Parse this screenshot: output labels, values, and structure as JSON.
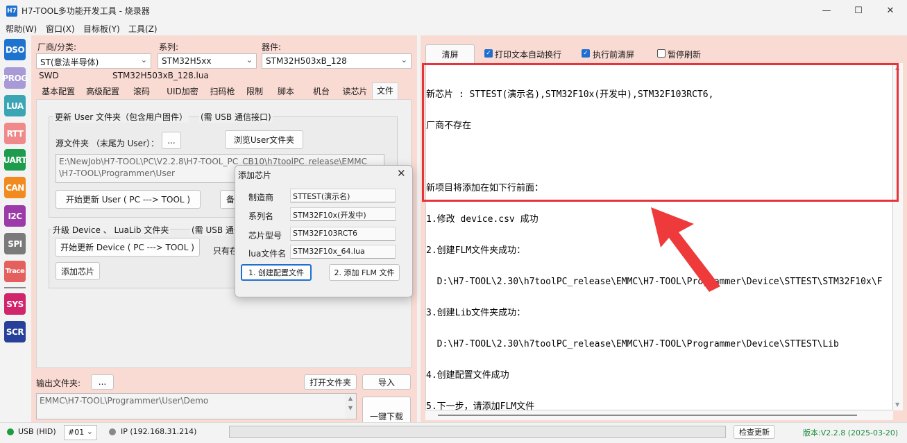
{
  "window": {
    "app_icon_label": "H7",
    "title": "H7-TOOL多功能开发工具 - 烧录器",
    "controls": {
      "minimize": "—",
      "maximize": "☐",
      "close": "✕"
    }
  },
  "menu": [
    {
      "label": "帮助(W)"
    },
    {
      "label": "窗口(X)"
    },
    {
      "label": "目标板(Y)"
    },
    {
      "label": "工具(Z)"
    }
  ],
  "toolbar": [
    {
      "label": "DSO",
      "color": "#1e73cf"
    },
    {
      "label": "PROG",
      "color": "#a89ad6"
    },
    {
      "label": "LUA",
      "color": "#3aa6b4"
    },
    {
      "label": "RTT",
      "color": "#f08a8a"
    },
    {
      "label": "UART",
      "color": "#1c9c4c"
    },
    {
      "label": "CAN",
      "color": "#f18b1f"
    },
    {
      "label": "I2C",
      "color": "#9b3aa8"
    },
    {
      "label": "SPI",
      "color": "#7a7a7a"
    },
    {
      "label": "Trace",
      "color": "#e4605e"
    },
    {
      "label": "SYS",
      "color": "#d0246b"
    },
    {
      "label": "SCR",
      "color": "#27419a"
    }
  ],
  "selectors": {
    "vendor_label": "厂商/分类:",
    "vendor_value": "ST(意法半导体)",
    "series_label": "系列:",
    "series_value": "STM32H5xx",
    "device_label": "器件:",
    "device_value": "STM32H503xB_128",
    "interface": "SWD",
    "lua_file": "STM32H503xB_128.lua"
  },
  "tabs": [
    {
      "label": "基本配置"
    },
    {
      "label": "高级配置"
    },
    {
      "label": "滚码"
    },
    {
      "label": "UID加密"
    },
    {
      "label": "扫码枪"
    },
    {
      "label": "限制"
    },
    {
      "label": "脚本"
    },
    {
      "label": "机台"
    },
    {
      "label": "读芯片"
    },
    {
      "label": "文件"
    }
  ],
  "file_tab": {
    "group1_title": "更新 User 文件夹（包含用户固件）",
    "group1_note": "(需 USB 通信接口)",
    "source_label": "源文件夹  （末尾为 User）：",
    "browse_dots": "...",
    "browse_user_button": "浏览User文件夹",
    "source_path_line1": "E:\\NewJob\\H7-TOOL\\PC\\V2.2.8\\H7-TOOL_PC_CB10\\h7toolPC_release\\EMMC",
    "source_path_line2": "\\H7-TOOL\\Programmer\\User",
    "start_update_user_button": "开始更新 User ( PC ---> TOOL )",
    "partial_button": "备",
    "group2_title": "升级 Device 、 LuaLib 文件夹",
    "group2_note": "(需 USB 通信",
    "start_update_device_button": "开始更新 Device ( PC ---> TOOL )",
    "only_label": "只有在",
    "add_chip_button": "添加芯片"
  },
  "output": {
    "label": "输出文件夹:",
    "dots": "...",
    "open_folder_button": "打开文件夹",
    "import_button": "导入",
    "path": "EMMC\\H7-TOOL\\Programmer\\User\\Demo",
    "download_button": "一键下载"
  },
  "dialog": {
    "title": "添加芯片",
    "fields": [
      {
        "label": "制造商",
        "value": "STTEST(演示名)"
      },
      {
        "label": "系列名",
        "value": "STM32F10x(开发中)"
      },
      {
        "label": "芯片型号",
        "value": "STM32F103RCT6"
      },
      {
        "label": "lua文件名",
        "value": "STM32F10x_64.lua"
      }
    ],
    "create_config_button": "1. 创建配置文件",
    "add_flm_button": "2. 添加 FLM 文件"
  },
  "log_panel": {
    "clear_button": "清屏",
    "options": [
      {
        "label": "打印文本自动换行",
        "checked": true
      },
      {
        "label": "执行前清屏",
        "checked": true
      },
      {
        "label": "暂停刷新",
        "checked": false
      }
    ],
    "lines": [
      "新芯片 : STTEST(演示名),STM32F10x(开发中),STM32F103RCT6,",
      "厂商不存在",
      "",
      "新项目将添加在如下行前面：",
      "1.修改 device.csv 成功",
      "2.创建FLM文件夹成功：",
      "  D:\\H7-TOOL\\2.30\\h7toolPC_release\\EMMC\\H7-TOOL\\Programmer\\Device\\STTEST\\STM32F10x\\F",
      "3.创建Lib文件夹成功：",
      "  D:\\H7-TOOL\\2.30\\h7toolPC_release\\EMMC\\H7-TOOL\\Programmer\\Device\\STTEST\\Lib",
      "4.创建配置文件成功",
      "5.下一步，请添加FLM文件"
    ],
    "highlight_color": "#e8333a"
  },
  "status": {
    "usb_label": "USB (HID)",
    "usb_color": "#1c9c3c",
    "port_value": "#01",
    "ip_label": "IP (192.168.31.214)",
    "ip_color": "#888888",
    "check_update_button": "检查更新",
    "version": "版本:V2.2.8 (2025-03-20)",
    "version_color": "#1c8c3c"
  }
}
